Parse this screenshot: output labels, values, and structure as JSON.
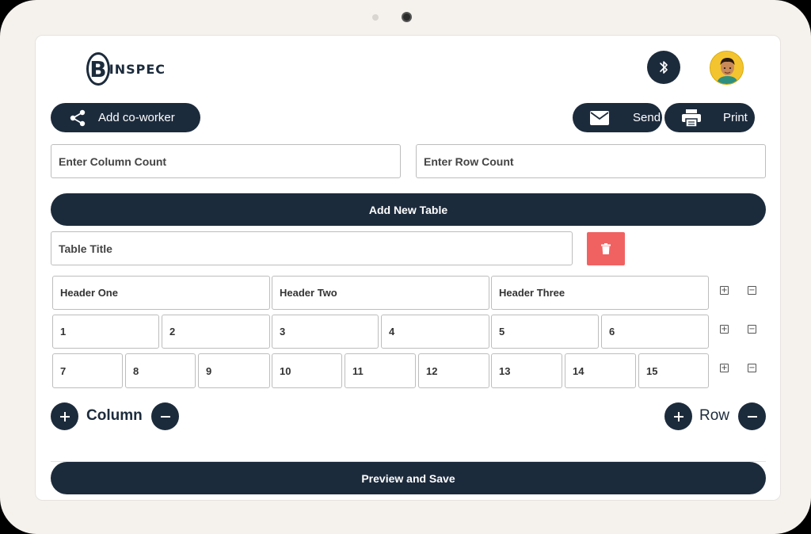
{
  "app": {
    "logo_letter": "B",
    "logo_text": "INSPEC"
  },
  "header": {
    "add_coworker_label": "Add co-worker",
    "send_label": "Send",
    "print_label": "Print"
  },
  "inputs": {
    "column_count_placeholder": "Enter Column Count",
    "row_count_placeholder": "Enter Row Count",
    "table_title_placeholder": "Table Title"
  },
  "buttons": {
    "add_new_table": "Add New Table",
    "preview_and_save": "Preview and Save",
    "column_label": "Column",
    "row_label": "Row"
  },
  "table": {
    "headers": [
      "Header One",
      "Header Two",
      "Header Three"
    ],
    "rows": [
      [
        "1",
        "2",
        "3",
        "4",
        "5",
        "6"
      ],
      [
        "7",
        "8",
        "9",
        "10",
        "11",
        "12",
        "13",
        "14",
        "15"
      ]
    ]
  },
  "colors": {
    "primary": "#1c2b3c",
    "danger": "#f06262"
  }
}
